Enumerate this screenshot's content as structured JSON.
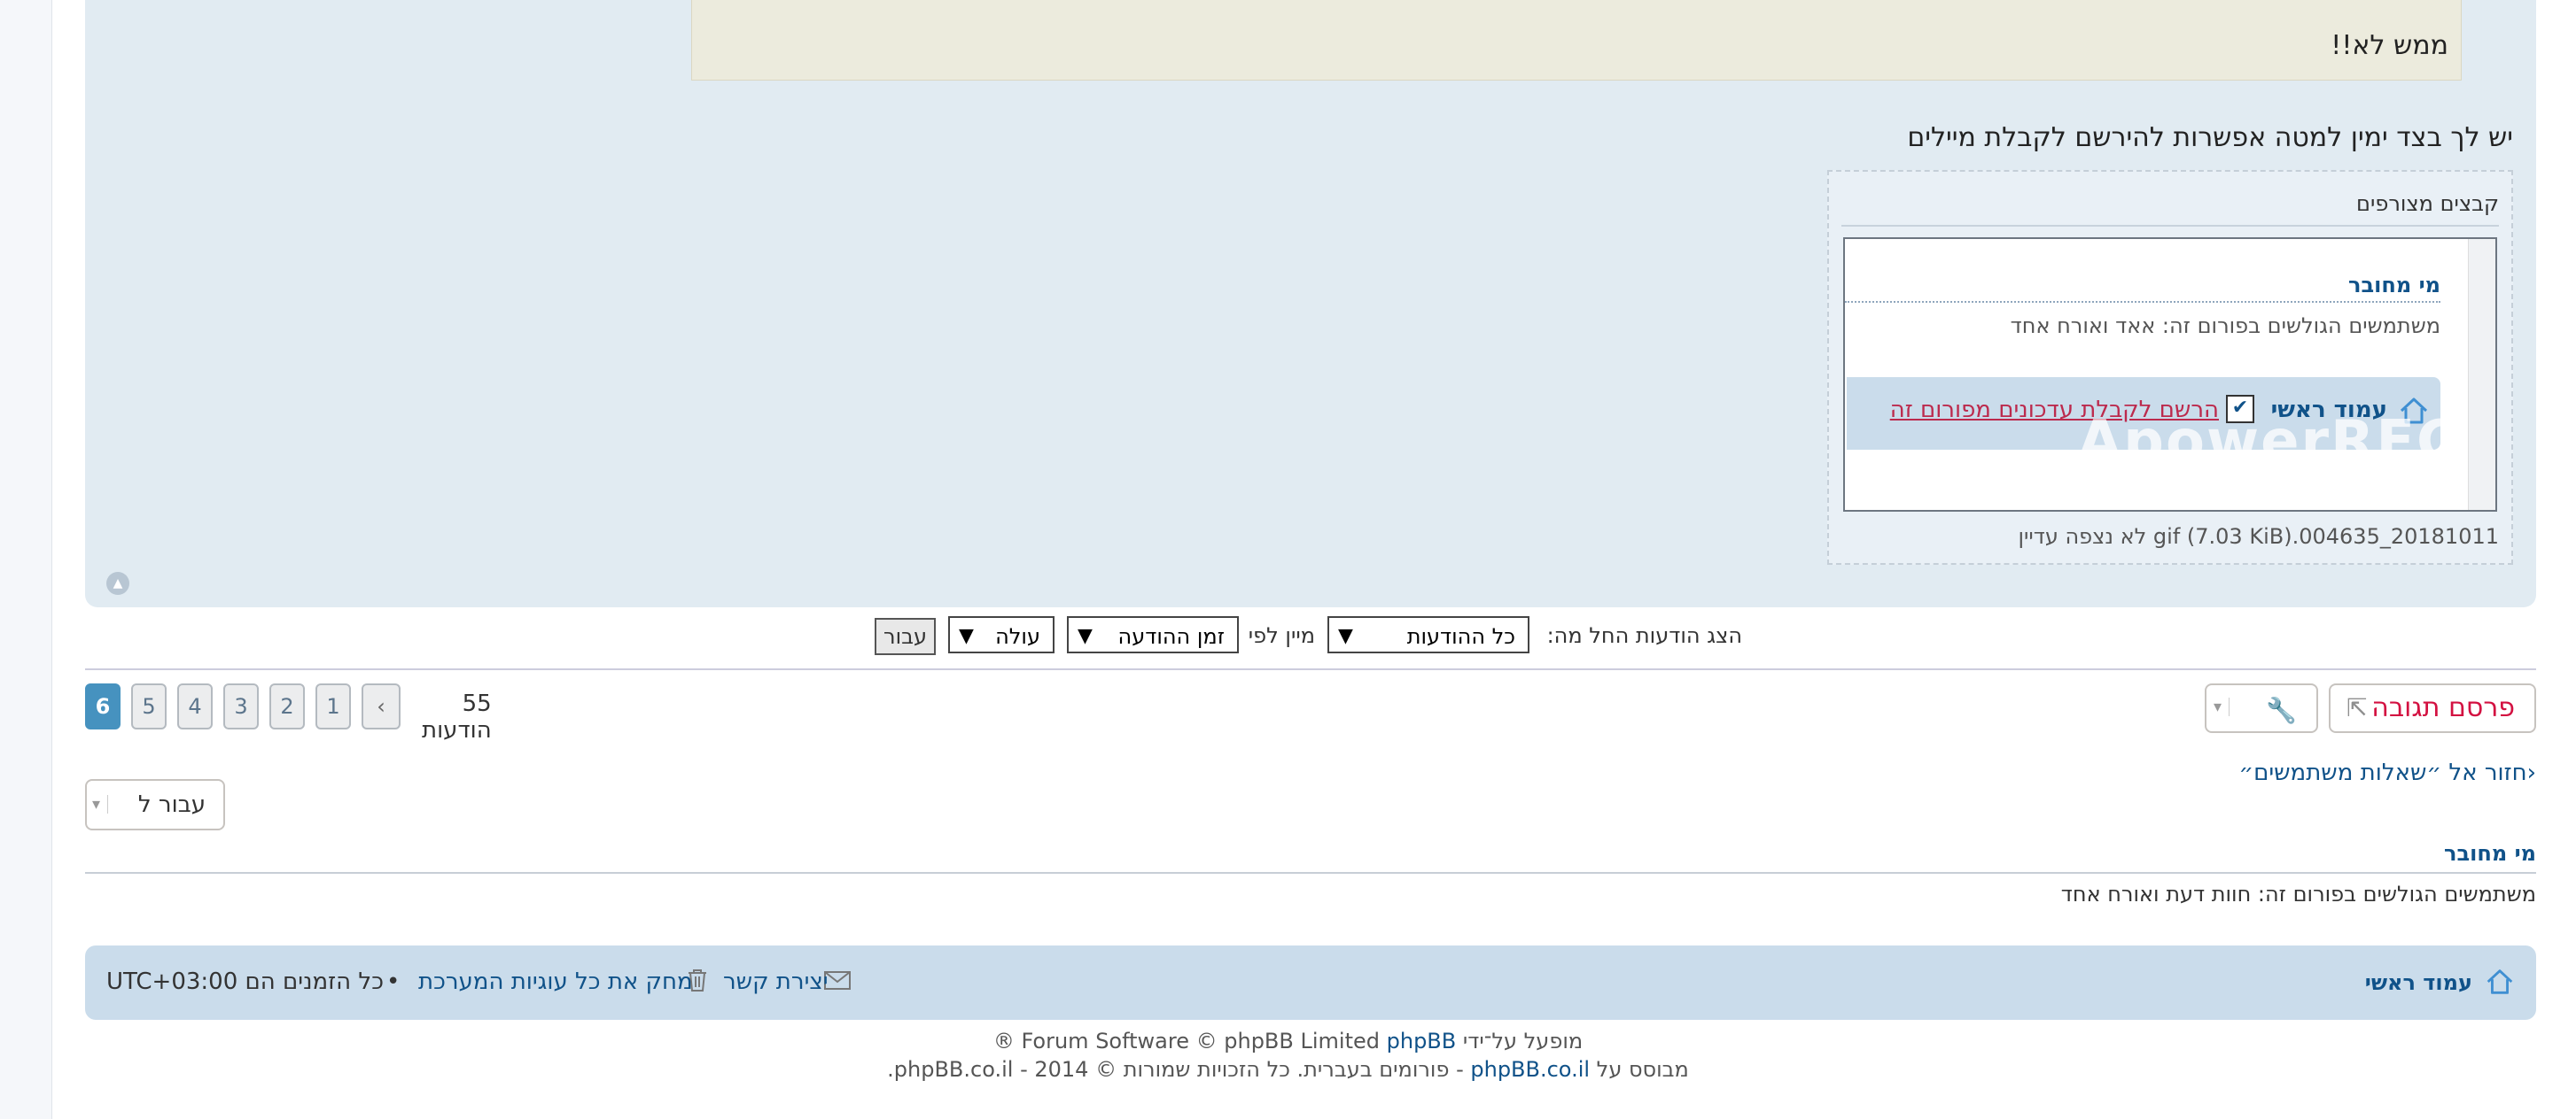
{
  "post": {
    "quote_text": "ממש לא!!",
    "body_text": "יש לך בצד ימין למטה אפשרות להירשם לקבלת מיילים",
    "attachments_title": "קבצים מצורפים",
    "attachment_caption": "20181011_004635.gif (7.03 KiB) לא נצפה עדיין",
    "attachment_image": {
      "who_title": "מי מחובר",
      "users_line": "משתמשים הגולשים בפורום זה: אאד ואורח אחד",
      "home_label": "עמוד ראשי",
      "subscribe_link": "הרשם לקבלת עדכונים מפורום זה",
      "checkmark": "✔",
      "watermark": "ApowerREC"
    }
  },
  "sort_bar": {
    "show_from_label": "הצג הודעות החל מה:",
    "show_from_value": "כל ההודעות",
    "sort_by_label": "מיין לפי",
    "sort_by_value": "זמן ההודעה",
    "order_value": "עולה",
    "go_label": "עבור",
    "select_arrow": "▼"
  },
  "actions": {
    "reply_label": "פרסם תגובה",
    "reply_icon": "reply-icon",
    "tools_icon": "wrench-icon",
    "caret": "▾"
  },
  "pagination": {
    "post_count": "55 הודעות",
    "prev_arrow": "‹",
    "pages": [
      "1",
      "2",
      "3",
      "4",
      "5",
      "6"
    ],
    "active_page": "6"
  },
  "navigation": {
    "back_link": "חזור אל ״שאלות משתמשים״",
    "back_arrow": "‹",
    "jump_label": "עבור ל"
  },
  "who_is_online": {
    "title": "מי מחובר",
    "users": "משתמשים הגולשים בפורום זה: חוות דעת ואורח אחד"
  },
  "footer_nav": {
    "home_label": "עמוד ראשי",
    "contact_label": "יצירת קשר",
    "delete_cookies_label": "מחק את כל עוגיות המערכת",
    "separator": "•",
    "timezone_text": "כל הזמנים הם UTC+03:00"
  },
  "copyright": {
    "line1_prefix": "מופעל על־ידי ",
    "line1_link": "phpBB",
    "line1_suffix": "® Forum Software © phpBB Limited",
    "line2_prefix": "מבוסס על ",
    "line2_link": "phpBB.co.il",
    "line2_suffix": " - פורומים בעברית. כל הזכויות שמורות © 2014 - phpBB.co.il."
  },
  "colors": {
    "panel_bg": "#e1ebf2",
    "link": "#105289",
    "reply_red": "#d31141",
    "active_page": "#4692bf",
    "footer_bg": "#cadceb"
  }
}
